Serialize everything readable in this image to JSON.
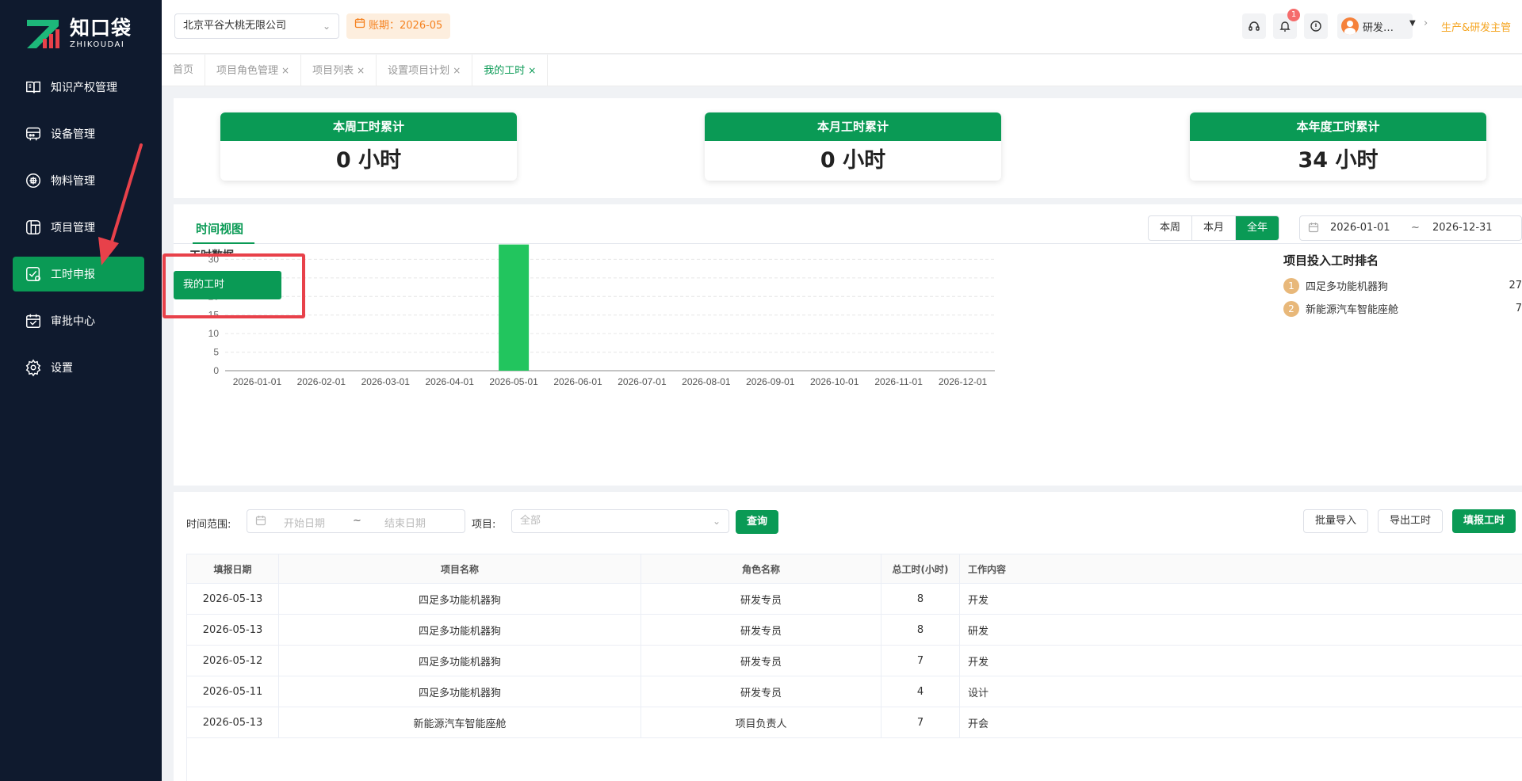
{
  "sidebar": {
    "logo": {
      "cn": "知口袋",
      "en": "ZHIKOUDAI"
    },
    "items": [
      {
        "label": "知识产权管理",
        "icon": "book-icon",
        "active": false
      },
      {
        "label": "设备管理",
        "icon": "device-icon",
        "active": false
      },
      {
        "label": "物料管理",
        "icon": "material-icon",
        "active": false
      },
      {
        "label": "项目管理",
        "icon": "project-icon",
        "active": false
      },
      {
        "label": "工时申报",
        "icon": "timesheet-icon",
        "active": true
      },
      {
        "label": "审批中心",
        "icon": "approval-icon",
        "active": false
      },
      {
        "label": "设置",
        "icon": "gear-icon",
        "active": false
      }
    ]
  },
  "header": {
    "company": "北京平谷大桃无限公司",
    "period": "账期：2026-05",
    "notification_count": "1",
    "user_name": "研发…",
    "role": "生产&研发主管"
  },
  "tabs": [
    {
      "label": "首页",
      "closable": false,
      "active": false
    },
    {
      "label": "项目角色管理",
      "closable": true,
      "active": false
    },
    {
      "label": "项目列表",
      "closable": true,
      "active": false
    },
    {
      "label": "设置项目计划",
      "closable": true,
      "active": false
    },
    {
      "label": "我的工时",
      "closable": true,
      "active": true
    }
  ],
  "stats": [
    {
      "title": "本周工时累计",
      "value": "0 小时"
    },
    {
      "title": "本月工时累计",
      "value": "0 小时"
    },
    {
      "title": "本年度工时累计",
      "value": "34 小时"
    }
  ],
  "chart_section": {
    "view_tab": "时间视图",
    "range_buttons": [
      "本周",
      "本月",
      "全年"
    ],
    "active_range": "全年",
    "date_from": "2026-01-01",
    "date_sep": "~",
    "date_to": "2026-12-31",
    "subtitle": "工时数据",
    "my_work_button": "我的工时",
    "ranking_title": "项目投入工时排名",
    "ranking": [
      {
        "rank": "1",
        "name": "四足多功能机器狗",
        "value": "27"
      },
      {
        "rank": "2",
        "name": "新能源汽车智能座舱",
        "value": "7"
      }
    ]
  },
  "chart_data": {
    "type": "bar",
    "categories": [
      "2026-01-01",
      "2026-02-01",
      "2026-03-01",
      "2026-04-01",
      "2026-05-01",
      "2026-06-01",
      "2026-07-01",
      "2026-08-01",
      "2026-09-01",
      "2026-10-01",
      "2026-11-01",
      "2026-12-01"
    ],
    "values": [
      0,
      0,
      0,
      0,
      34,
      0,
      0,
      0,
      0,
      0,
      0,
      0
    ],
    "yticks": [
      "0",
      "5",
      "10",
      "15",
      "20",
      "25",
      "30"
    ],
    "ylim": [
      0,
      35
    ],
    "grid": true,
    "bar_color": "#22c55e"
  },
  "filters": {
    "time_label": "时间范围:",
    "start_placeholder": "开始日期",
    "sep": "~",
    "end_placeholder": "结束日期",
    "project_label": "项目:",
    "project_value": "全部",
    "query_button": "查询",
    "import_button": "批量导入",
    "export_button": "导出工时",
    "fill_button": "填报工时"
  },
  "table": {
    "headers": [
      "填报日期",
      "项目名称",
      "角色名称",
      "总工时(小时)",
      "工作内容"
    ],
    "rows": [
      [
        "2026-05-13",
        "四足多功能机器狗",
        "研发专员",
        "8",
        "开发"
      ],
      [
        "2026-05-13",
        "四足多功能机器狗",
        "研发专员",
        "8",
        "研发"
      ],
      [
        "2026-05-12",
        "四足多功能机器狗",
        "研发专员",
        "7",
        "开发"
      ],
      [
        "2026-05-11",
        "四足多功能机器狗",
        "研发专员",
        "4",
        "设计"
      ],
      [
        "2026-05-13",
        "新能源汽车智能座舱",
        "项目负责人",
        "7",
        "开会"
      ]
    ]
  },
  "colors": {
    "brand": "#0a9a55",
    "sidebar_bg": "#0f1a2e",
    "period_text": "#f58220",
    "annotation_red": "#e8414a"
  }
}
